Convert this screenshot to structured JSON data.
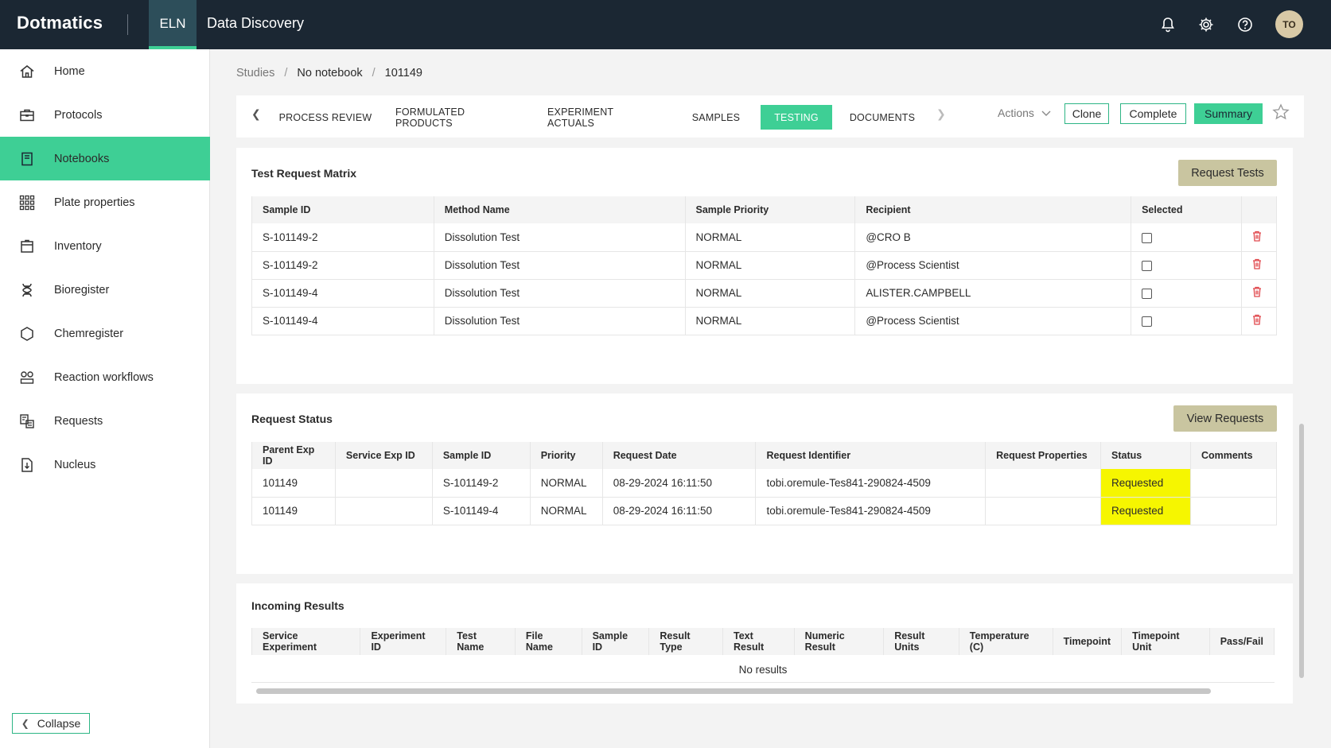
{
  "topbar": {
    "logo": "Dotmatics",
    "eln_tab": "ELN",
    "app_title": "Data Discovery",
    "avatar_initials": "TO",
    "icons": [
      "bell-icon",
      "gear-icon",
      "help-icon"
    ]
  },
  "sidebar": {
    "items": [
      {
        "label": "Home",
        "icon": "home-icon"
      },
      {
        "label": "Protocols",
        "icon": "briefcase-icon"
      },
      {
        "label": "Notebooks",
        "icon": "notebook-icon"
      },
      {
        "label": "Plate properties",
        "icon": "grid-icon"
      },
      {
        "label": "Inventory",
        "icon": "inventory-icon"
      },
      {
        "label": "Bioregister",
        "icon": "dna-icon"
      },
      {
        "label": "Chemregister",
        "icon": "hexagon-icon"
      },
      {
        "label": "Reaction workflows",
        "icon": "workflow-icon"
      },
      {
        "label": "Requests",
        "icon": "requests-icon"
      },
      {
        "label": "Nucleus",
        "icon": "nucleus-icon"
      }
    ],
    "active": "Notebooks",
    "collapse_label": "Collapse"
  },
  "breadcrumb": {
    "studies": "Studies",
    "notebook": "No notebook",
    "current": "101149"
  },
  "tabs": {
    "items": [
      "PROCESS REVIEW",
      "FORMULATED PRODUCTS",
      "EXPERIMENT ACTUALS",
      "SAMPLES",
      "TESTING",
      "DOCUMENTS"
    ],
    "active": "TESTING",
    "actions_label": "Actions",
    "clone_label": "Clone",
    "complete_label": "Complete",
    "summary_label": "Summary"
  },
  "test_request_matrix": {
    "title": "Test Request Matrix",
    "button": "Request Tests",
    "columns": [
      "Sample ID",
      "Method Name",
      "Sample Priority",
      "Recipient",
      "Selected"
    ],
    "rows": [
      {
        "sample_id": "S-101149-2",
        "method": "Dissolution Test",
        "priority": "NORMAL",
        "recipient": "@CRO B"
      },
      {
        "sample_id": "S-101149-2",
        "method": "Dissolution Test",
        "priority": "NORMAL",
        "recipient": "@Process Scientist"
      },
      {
        "sample_id": "S-101149-4",
        "method": "Dissolution Test",
        "priority": "NORMAL",
        "recipient": "ALISTER.CAMPBELL"
      },
      {
        "sample_id": "S-101149-4",
        "method": "Dissolution Test",
        "priority": "NORMAL",
        "recipient": "@Process Scientist"
      }
    ]
  },
  "request_status": {
    "title": "Request Status",
    "button": "View Requests",
    "columns": [
      "Parent Exp ID",
      "Service Exp ID",
      "Sample ID",
      "Priority",
      "Request Date",
      "Request Identifier",
      "Request Properties",
      "Status",
      "Comments"
    ],
    "rows": [
      {
        "parent": "101149",
        "service": "",
        "sample_id": "S-101149-2",
        "priority": "NORMAL",
        "date": "08-29-2024 16:11:50",
        "identifier": "tobi.oremule-Tes841-290824-4509",
        "properties": "",
        "status": "Requested",
        "comments": ""
      },
      {
        "parent": "101149",
        "service": "",
        "sample_id": "S-101149-4",
        "priority": "NORMAL",
        "date": "08-29-2024 16:11:50",
        "identifier": "tobi.oremule-Tes841-290824-4509",
        "properties": "",
        "status": "Requested",
        "comments": ""
      }
    ],
    "status_color": "#f6f600"
  },
  "incoming_results": {
    "title": "Incoming Results",
    "columns": [
      "Service Experiment",
      "Experiment ID",
      "Test Name",
      "File Name",
      "Sample ID",
      "Result Type",
      "Text Result",
      "Numeric Result",
      "Result Units",
      "Temperature (C)",
      "Timepoint",
      "Timepoint Unit",
      "Pass/Fail"
    ],
    "empty_text": "No results"
  },
  "colors": {
    "accent": "#3ecf95",
    "topbar": "#1b2733",
    "panel_button": "#c9c5a0",
    "delete": "#e0474c"
  }
}
